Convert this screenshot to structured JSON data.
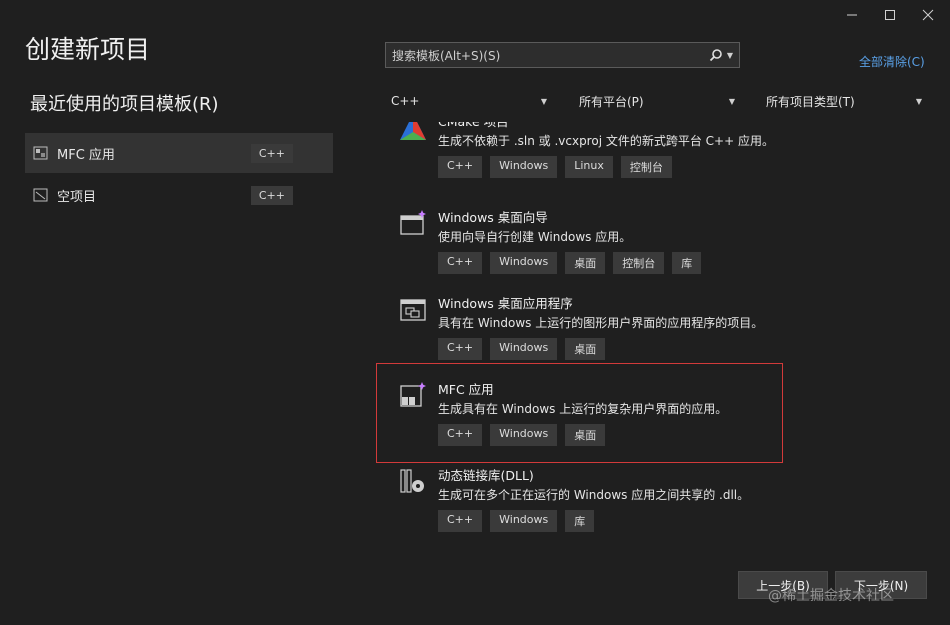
{
  "window": {
    "title": "创建新项目",
    "controls": [
      "minimize-icon",
      "maximize-icon",
      "close-icon"
    ]
  },
  "recent": {
    "heading": "最近使用的项目模板(R)",
    "items": [
      {
        "label": "MFC 应用",
        "badge": "C++",
        "icon": "mfc-app-icon"
      },
      {
        "label": "空项目",
        "badge": "C++",
        "icon": "empty-project-icon"
      }
    ]
  },
  "search": {
    "placeholder": "搜索模板(Alt+S)(S)",
    "clear_all": "全部清除(C)"
  },
  "filters": {
    "language": "C++",
    "platform": "所有平台(P)",
    "project_type": "所有项目类型(T)"
  },
  "templates": [
    {
      "name": "CMake 项目",
      "desc": "生成不依赖于 .sln 或 .vcxproj 文件的新式跨平台 C++ 应用。",
      "tags": [
        "C++",
        "Windows",
        "Linux",
        "控制台"
      ]
    },
    {
      "name": "Windows 桌面向导",
      "desc": "使用向导自行创建 Windows 应用。",
      "tags": [
        "C++",
        "Windows",
        "桌面",
        "控制台",
        "库"
      ]
    },
    {
      "name": "Windows 桌面应用程序",
      "desc": "具有在 Windows 上运行的图形用户界面的应用程序的项目。",
      "tags": [
        "C++",
        "Windows",
        "桌面"
      ]
    },
    {
      "name": "MFC 应用",
      "desc": "生成具有在 Windows 上运行的复杂用户界面的应用。",
      "tags": [
        "C++",
        "Windows",
        "桌面"
      ]
    },
    {
      "name": "动态链接库(DLL)",
      "desc": "生成可在多个正在运行的 Windows 应用之间共享的 .dll。",
      "tags": [
        "C++",
        "Windows",
        "库"
      ]
    }
  ],
  "buttons": {
    "back": "上一步(B)",
    "next": "下一步(N)"
  },
  "watermark": "@稀土掘金技术社区",
  "colors": {
    "background": "#1f1f1f",
    "link": "#5aa0e6",
    "highlight": "#d23a3a",
    "tag_bg": "#3a3a3a"
  }
}
